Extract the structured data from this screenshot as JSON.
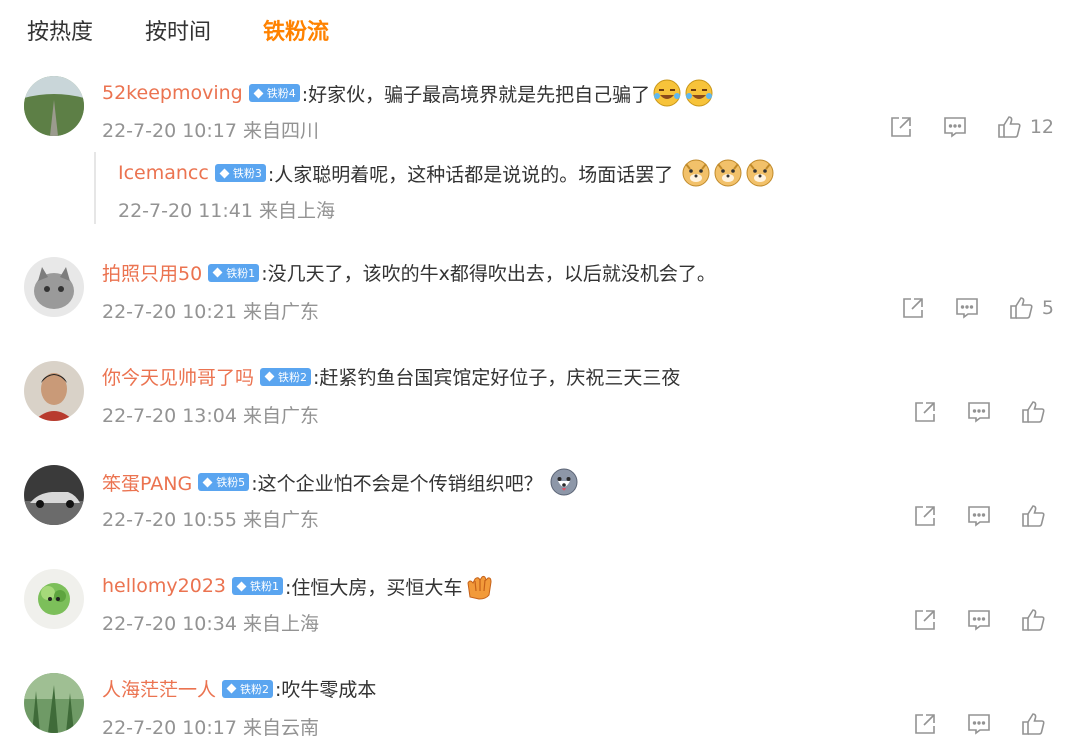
{
  "tabs": [
    {
      "label": "按热度"
    },
    {
      "label": "按时间"
    },
    {
      "label": "铁粉流"
    }
  ],
  "comments": [
    {
      "username": "52keepmoving",
      "badge": "铁粉4",
      "text": ":好家伙，骗子最高境界就是先把自己骗了",
      "meta": "22-7-20 10:17 来自四川",
      "likes": "12",
      "reply": {
        "username": "Icemancc",
        "badge": "铁粉3",
        "text": ":人家聪明着呢，这种话都是说说的。场面话罢了",
        "meta": "22-7-20 11:41 来自上海"
      }
    },
    {
      "username": "拍照只用50",
      "badge": "铁粉1",
      "text": ":没几天了，该吹的牛x都得吹出去，以后就没机会了。",
      "meta": "22-7-20 10:21 来自广东",
      "likes": "5"
    },
    {
      "username": "你今天见帅哥了吗",
      "badge": "铁粉2",
      "text": ":赶紧钓鱼台国宾馆定好位子，庆祝三天三夜",
      "meta": "22-7-20 13:04 来自广东",
      "likes": ""
    },
    {
      "username": "笨蛋PANG",
      "badge": "铁粉5",
      "text": ":这个企业怕不会是个传销组织吧？",
      "meta": "22-7-20 10:55 来自广东",
      "likes": ""
    },
    {
      "username": "hellomy2023",
      "badge": "铁粉1",
      "text": ":住恒大房，买恒大车",
      "meta": "22-7-20 10:34 来自上海",
      "likes": ""
    },
    {
      "username": "人海茫茫一人",
      "badge": "铁粉2",
      "text": ":吹牛零成本",
      "meta": "22-7-20 10:17 来自云南",
      "likes": ""
    }
  ],
  "colors": {
    "accent": "#ff8200",
    "username": "#eb7350",
    "badge": "#5aa5f0",
    "meta": "#939393"
  }
}
